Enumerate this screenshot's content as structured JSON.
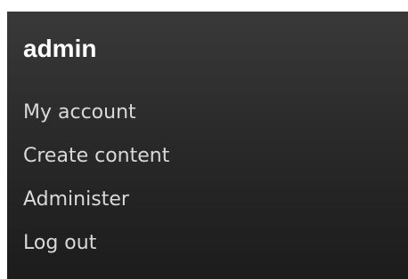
{
  "block": {
    "title": "admin",
    "menu": [
      {
        "label": "My account"
      },
      {
        "label": "Create content"
      },
      {
        "label": "Administer"
      },
      {
        "label": "Log out"
      }
    ]
  },
  "colors": {
    "page_background": "#ffffff",
    "block_background_top": "#393939",
    "block_background_bottom": "#1c1c1c",
    "title_text": "#ffffff",
    "link_text": "#d9d9d9"
  }
}
